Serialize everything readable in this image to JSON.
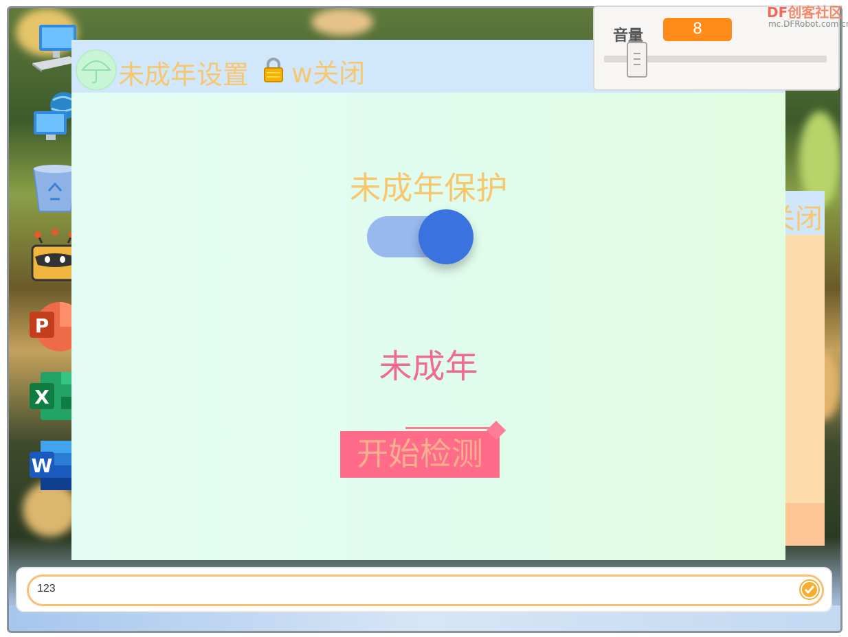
{
  "main_window": {
    "title": "未成年设置",
    "close_label": "w关闭",
    "heading": "未成年保护",
    "toggle_state": "on",
    "status": "未成年",
    "start_button": "开始检测"
  },
  "back_window": {
    "close_label": "关闭"
  },
  "volume_panel": {
    "label": "音量",
    "value": "8",
    "slider_level": 0.11
  },
  "logo": {
    "brand_df": "DF",
    "brand_text": "创客社区",
    "url": "mc.DFRobot.com.cn"
  },
  "input_bar": {
    "value": "123"
  },
  "desktop_icons": [
    "computer-icon",
    "network-icon",
    "recycle-bin-icon",
    "robot-app-icon",
    "powerpoint-icon",
    "excel-icon",
    "word-icon"
  ],
  "colors": {
    "title_text": "#f6c76e",
    "toggle_knob": "#3a73df",
    "status_text": "#f06a98",
    "button_bg": "#ff6b88",
    "volume_value_bg": "#ff8c1a",
    "input_border": "#f9c074"
  }
}
